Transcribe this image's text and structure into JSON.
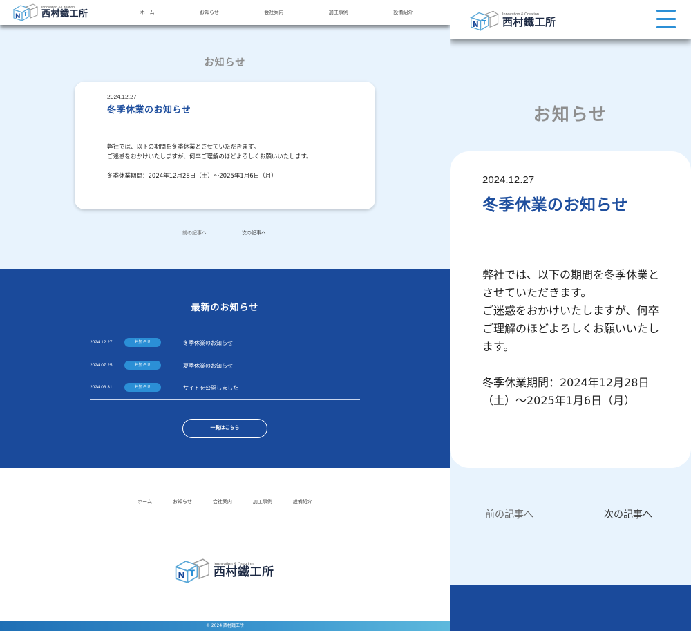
{
  "brand": {
    "tagline": "Innovation & Creation",
    "company": "西村鐵工所",
    "colors": {
      "primary": "#1a4a9b",
      "accent": "#2b8fd6",
      "page_bg": "#e8f3fd"
    }
  },
  "nav": {
    "items": [
      "ホーム",
      "お知らせ",
      "会社案内",
      "加工事例",
      "設備紹介"
    ]
  },
  "page": {
    "title": "お知らせ"
  },
  "article": {
    "date": "2024.12.27",
    "title": "冬季休業のお知らせ",
    "body_line1": "弊社では、以下の期間を冬季休業とさせていただきます。",
    "body_line2": "ご迷惑をおかけいたしますが、何卒ご理解のほどよろしくお願いいたします。",
    "period": "冬季休業期間：2024年12月28日（土）～2025年1月6日（月）"
  },
  "pager": {
    "prev": "前の記事へ",
    "next": "次の記事へ"
  },
  "latest_news": {
    "title": "最新のお知らせ",
    "items": [
      {
        "date": "2024.12.27",
        "category": "お知らせ",
        "title": "冬季休業のお知らせ"
      },
      {
        "date": "2024.07.25",
        "category": "お知らせ",
        "title": "夏季休業のお知らせ"
      },
      {
        "date": "2024.03.31",
        "category": "お知らせ",
        "title": "サイトを公開しました"
      }
    ],
    "more_label": "一覧はこちら"
  },
  "footer": {
    "nav": [
      "ホーム",
      "お知らせ",
      "会社案内",
      "加工事例",
      "設備紹介"
    ],
    "copyright": "© 2024 西村鐵工所"
  },
  "icons": {
    "logo": "nt-cube-logo",
    "menu": "hamburger-menu-icon"
  }
}
